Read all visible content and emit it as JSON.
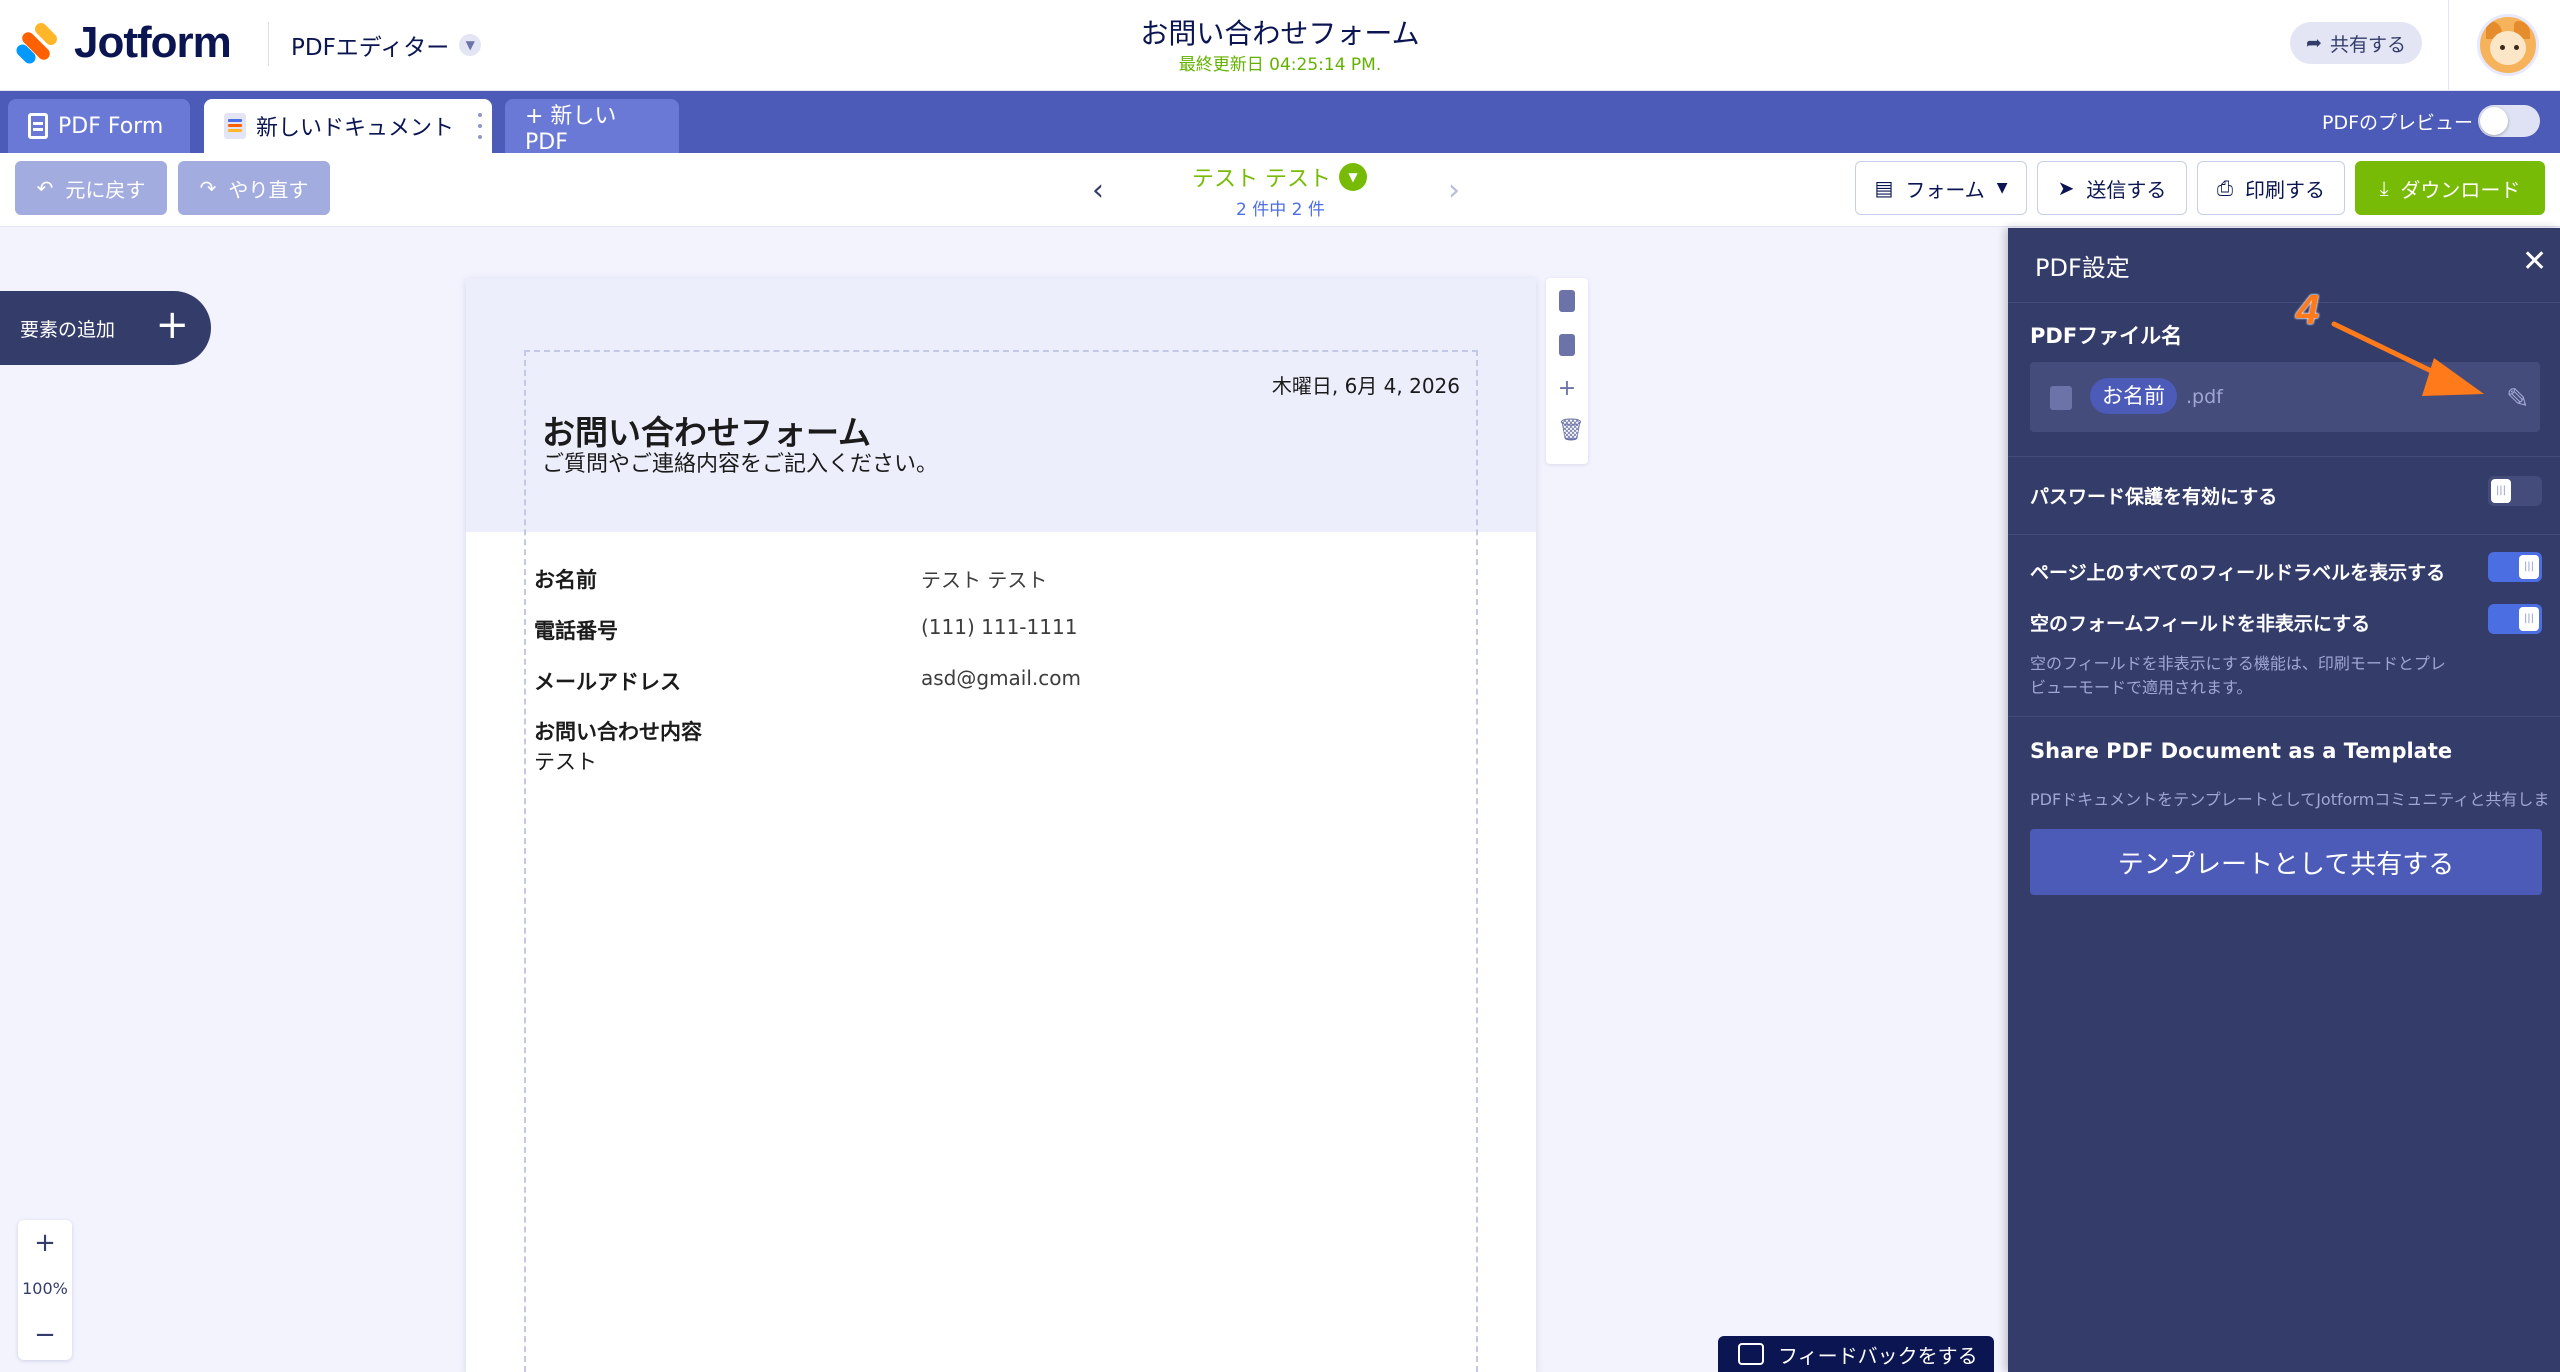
{
  "header": {
    "logo_text": "Jotform",
    "app_switcher": "PDFエディター",
    "doc_title": "お問い合わせフォーム",
    "last_updated": "最終更新日 04:25:14 PM.",
    "share_label": "共有する"
  },
  "tabs": {
    "pdf_form": "PDF Form",
    "document": "新しいドキュメント",
    "new_pdf": "+ 新しいPDF",
    "preview_label": "PDFのプレビュー",
    "preview_on": false
  },
  "toolbar": {
    "undo": "元に戻す",
    "redo": "やり直す",
    "submission_name": "テスト テスト",
    "submission_count": "2 件中 2 件",
    "form": "フォーム",
    "send": "送信する",
    "print": "印刷する",
    "download": "ダウンロード"
  },
  "canvas": {
    "add_element": "要素の追加",
    "zoom_level": "100%",
    "feedback": "フィードバックをする"
  },
  "document": {
    "date": "木曜日, 6月 4, 2026",
    "title": "お問い合わせフォーム",
    "subtitle": "ご質問やご連絡内容をご記入ください。",
    "fields": [
      {
        "label": "お名前",
        "value": "テスト テスト"
      },
      {
        "label": "電話番号",
        "value": "(111) 111-1111"
      },
      {
        "label": "メールアドレス",
        "value": "asd@gmail.com"
      },
      {
        "label": "お問い合わせ内容",
        "value": "テスト"
      }
    ]
  },
  "settings_panel": {
    "title": "PDF設定",
    "file_name_label": "PDFファイル名",
    "file_name_field": "お名前",
    "file_ext": ".pdf",
    "password_label": "パスワード保護を有効にする",
    "password_on": false,
    "show_labels_label": "ページ上のすべてのフィールドラベルを表示する",
    "show_labels_on": true,
    "hide_empty_label": "空のフォームフィールドを非表示にする",
    "hide_empty_on": true,
    "hide_empty_help": "空のフィールドを非表示にする機能は、印刷モードとプレビューモードで適用されます。",
    "template_title": "Share PDF Document as a Template",
    "template_desc": "PDFドキュメントをテンプレートとしてJotformコミュニティと共有しま",
    "template_button": "テンプレートとして共有する"
  },
  "annotation": {
    "step_number": "4"
  },
  "colors": {
    "brand_navy": "#0a1551",
    "tab_bar": "#4c5ab8",
    "panel_bg": "#343c6a",
    "accent_green": "#78bb07",
    "toggle_on": "#4c6ee3",
    "annotation_orange": "#ff7a1a"
  }
}
